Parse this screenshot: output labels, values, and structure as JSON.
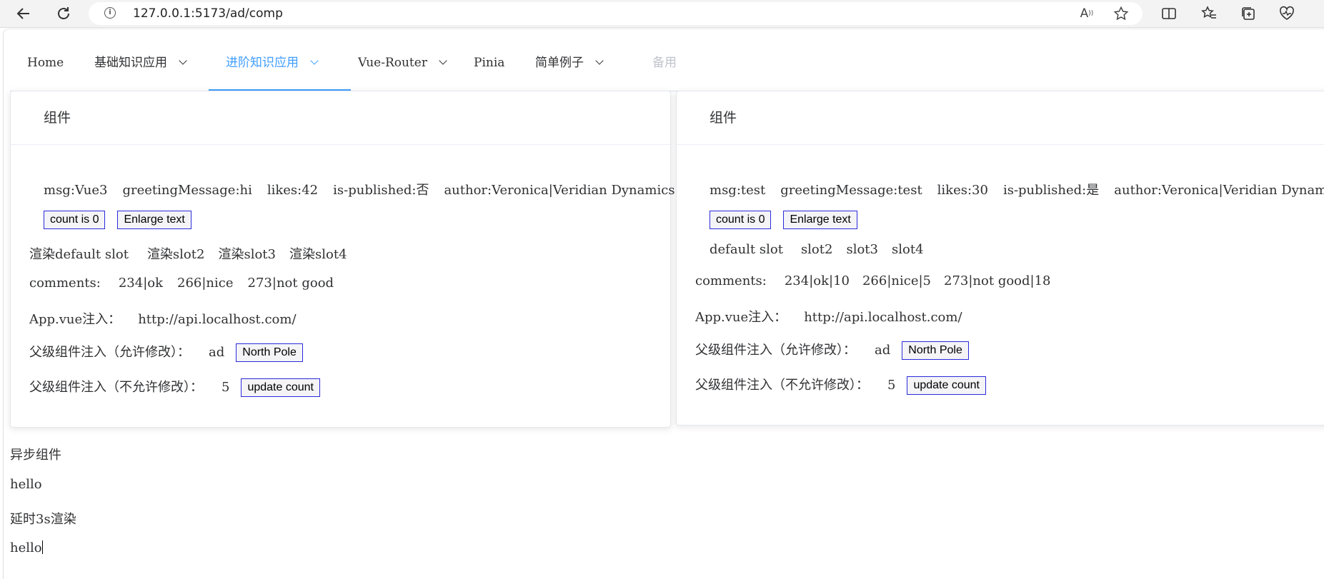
{
  "browser": {
    "url_host": "127.0.0.1",
    "url_path": ":5173/ad/comp",
    "icons": [
      "back-icon",
      "refresh-icon",
      "info-icon",
      "read-aloud-icon",
      "favorite-star-icon",
      "split-screen-icon",
      "favorites-icon",
      "collections-icon",
      "health-icon"
    ]
  },
  "menu": {
    "items": [
      {
        "label": "Home"
      },
      {
        "label": "基础知识应用"
      },
      {
        "label": "进阶知识应用"
      },
      {
        "label": "Vue-Router"
      },
      {
        "label": "Pinia"
      },
      {
        "label": "简单例子"
      },
      {
        "label": "备用"
      }
    ],
    "active_color": "#409eff"
  },
  "card_left": {
    "header": "组件",
    "props": {
      "msg": "msg:Vue3",
      "greeting": "greetingMessage:hi",
      "likes": "likes:42",
      "published": "is-published:否",
      "author": "author:Veronica|Veridian Dynamics"
    },
    "count_button": "count is 0",
    "enlarge_button": "Enlarge text",
    "slots": [
      "渲染default slot",
      "渲染slot2",
      "渲染slot3",
      "渲染slot4"
    ],
    "comments_label": "comments:",
    "comments": [
      "234|ok",
      "266|nice",
      "273|not good"
    ],
    "app_inject_label": "App.vue注入：",
    "app_inject_value": "http://api.localhost.com/",
    "parent_inject_label": "父级组件注入（允许修改）：",
    "parent_inject_value": "ad",
    "parent_inject_button": "North Pole",
    "readonly_inject_label": "父级组件注入（不允许修改）：",
    "readonly_inject_value": "5",
    "readonly_inject_button": "update count"
  },
  "card_right": {
    "header": "组件",
    "props": {
      "msg": "msg:test",
      "greeting": "greetingMessage:test",
      "likes": "likes:30",
      "published": "is-published:是",
      "author": "author:Veronica|Veridian Dynamics"
    },
    "count_button": "count is 0",
    "enlarge_button": "Enlarge text",
    "slots": [
      "default slot",
      "slot2",
      "slot3",
      "slot4"
    ],
    "comments_label": "comments:",
    "comments": [
      "234|ok|10",
      "266|nice|5",
      "273|not good|18"
    ],
    "app_inject_label": "App.vue注入：",
    "app_inject_value": "http://api.localhost.com/",
    "parent_inject_label": "父级组件注入（允许修改）：",
    "parent_inject_value": "ad",
    "parent_inject_button": "North Pole",
    "readonly_inject_label": "父级组件注入（不允许修改）：",
    "readonly_inject_value": "5",
    "readonly_inject_button": "update count"
  },
  "async": {
    "title": "异步组件",
    "hello1": "hello",
    "delayed_title": "延时3s渲染",
    "hello2": "hello"
  }
}
